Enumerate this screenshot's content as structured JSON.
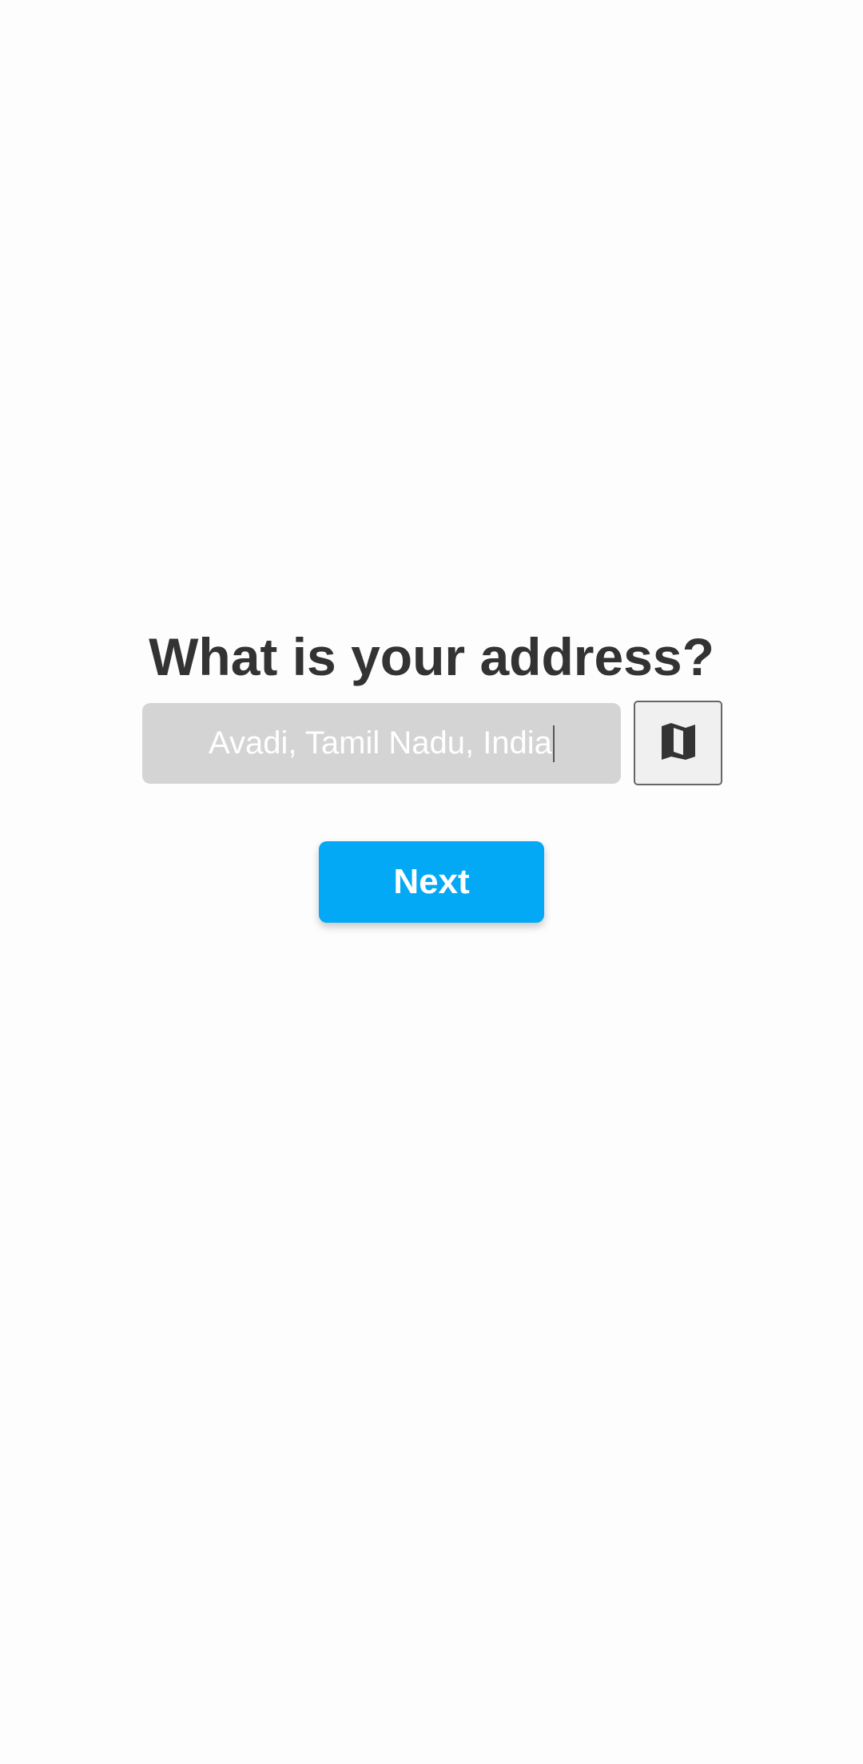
{
  "heading": "What is your address?",
  "address": {
    "value": "Avadi, Tamil Nadu, India"
  },
  "map_button": {
    "icon": "map-icon"
  },
  "next_button": {
    "label": "Next"
  },
  "colors": {
    "accent": "#03a9f4",
    "heading": "#333333",
    "field_background": "#d4d4d4",
    "page_background": "#fdfdfd"
  }
}
